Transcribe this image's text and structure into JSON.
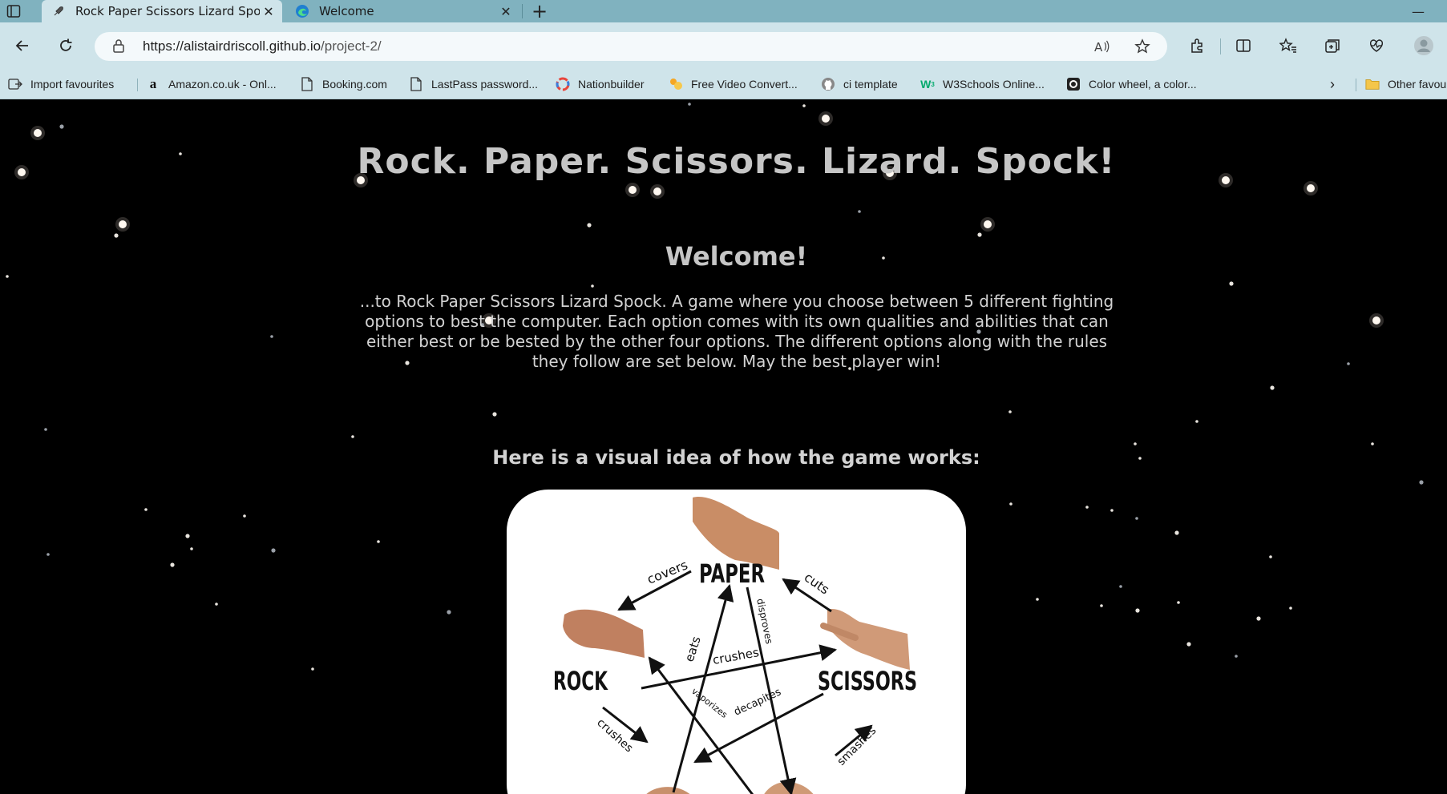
{
  "browser": {
    "tabs": [
      {
        "title": "Rock Paper Scissors Lizard Spock",
        "active": true
      },
      {
        "title": "Welcome",
        "active": false
      }
    ],
    "url": {
      "host": "https://alistairdriscoll.github.io",
      "path": "/project-2/"
    },
    "favourites": [
      {
        "label": "Import favourites",
        "icon": "import-icon"
      },
      {
        "label": "Amazon.co.uk - Onl...",
        "icon": "amazon-icon"
      },
      {
        "label": "Booking.com",
        "icon": "page-icon"
      },
      {
        "label": "LastPass password...",
        "icon": "page-icon"
      },
      {
        "label": "Nationbuilder",
        "icon": "nationbuilder-icon"
      },
      {
        "label": "Free Video Convert...",
        "icon": "converter-icon"
      },
      {
        "label": "ci template",
        "icon": "github-icon"
      },
      {
        "label": "W3Schools Online...",
        "icon": "w3schools-icon"
      },
      {
        "label": "Color wheel, a color...",
        "icon": "colorwheel-icon"
      },
      {
        "label": "Other favourites",
        "icon": "folder-icon"
      }
    ],
    "theme": {
      "tabbar": "#80b2bf",
      "toolbar": "#cfe4ea"
    }
  },
  "page": {
    "title": "Rock. Paper. Scissors. Lizard. Spock!",
    "welcome_heading": "Welcome!",
    "intro": "...to Rock Paper Scissors Lizard Spock. A game where you choose between 5 different fighting options to best the computer. Each option comes with its own qualities and abilities that can either best or be bested by the other four options. The different options along with the rules they follow are set below. May the best player win!",
    "visual_heading": "Here is a visual idea of how the game works:",
    "diagram": {
      "nodes": {
        "paper": "PAPER",
        "rock": "ROCK",
        "scissors": "SCISSORS"
      },
      "verbs": {
        "covers": "covers",
        "cuts": "cuts",
        "disproves": "disproves",
        "eats": "eats",
        "crushes_mid": "crushes",
        "vaporizes": "vaporizes",
        "decapites": "decapites",
        "crushes_low": "crushes",
        "smashes": "smashes"
      }
    },
    "background": "#000000"
  }
}
